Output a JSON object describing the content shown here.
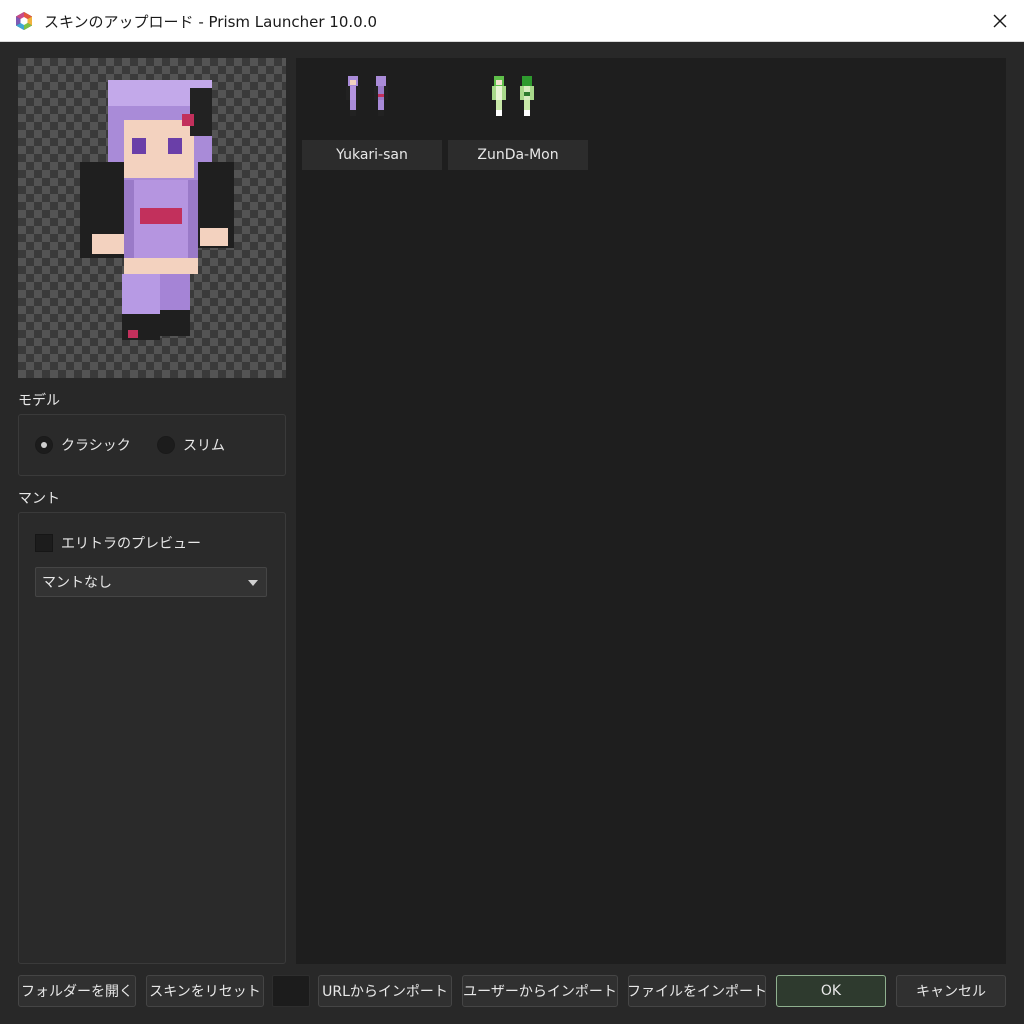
{
  "window": {
    "title": "スキンのアップロード - Prism Launcher 10.0.0",
    "app_icon": "prism-launcher-icon",
    "close_icon": "close-icon"
  },
  "model": {
    "label": "モデル",
    "options": [
      {
        "label": "クラシック",
        "checked": true
      },
      {
        "label": "スリム",
        "checked": false
      }
    ]
  },
  "cape": {
    "label": "マント",
    "preview_checkbox": {
      "label": "エリトラのプレビュー",
      "checked": false
    },
    "select_value": "マントなし"
  },
  "skins": [
    {
      "name": "Yukari-san",
      "colors": {
        "primary": "#a98bd8",
        "dark": "#222222",
        "accent": "#c2305c"
      }
    },
    {
      "name": "ZunDa-Mon",
      "colors": {
        "primary": "#a8d88a",
        "dark": "#2e7a2e",
        "accent": "#e8f4d4"
      }
    }
  ],
  "buttons": {
    "open_folder": "フォルダーを開く",
    "reset_skin": "スキンをリセット",
    "import_url": "URLからインポート",
    "import_user": "ユーザーからインポート",
    "import_file": "ファイルをインポート",
    "ok": "OK",
    "cancel": "キャンセル"
  }
}
